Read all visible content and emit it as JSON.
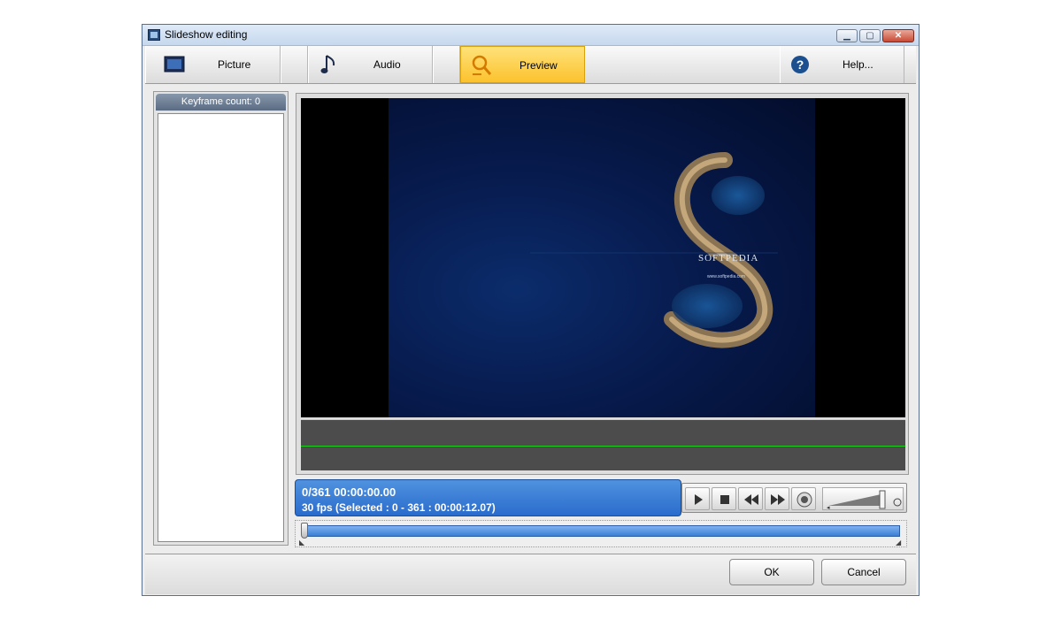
{
  "window": {
    "title": "Slideshow editing",
    "title_icon": "filmstrip-icon",
    "controls": {
      "minimize": "minimize-icon",
      "maximize": "maximize-icon",
      "close": "close-icon"
    }
  },
  "toolbar": {
    "items": [
      {
        "label": "Picture",
        "icon": "picture-icon"
      },
      {
        "label": "Audio",
        "icon": "music-note-icon"
      },
      {
        "label": "Preview",
        "icon": "preview-magnifier-icon",
        "active": true
      },
      {
        "label": "Help...",
        "icon": "help-icon"
      }
    ],
    "active_color": "#fbc22d"
  },
  "keyframes": {
    "header": "Keyframe count: 0",
    "items": []
  },
  "preview": {
    "slide_text": "SOFTPEDIA",
    "slide_subtext": "www.softpedia.com"
  },
  "status": {
    "line1": "0/361  00:00:00.00",
    "line2": "30  fps  (Selected : 0 - 361 : 00:00:12.07)",
    "color": "#2a6ccc"
  },
  "playback": {
    "buttons": [
      "play-icon",
      "stop-icon",
      "rewind-icon",
      "fast-forward-icon",
      "speaker-icon"
    ],
    "volume_level": 0.9
  },
  "scrubber": {
    "position_fraction": 0.0
  },
  "dialog": {
    "ok_label": "OK",
    "cancel_label": "Cancel"
  }
}
